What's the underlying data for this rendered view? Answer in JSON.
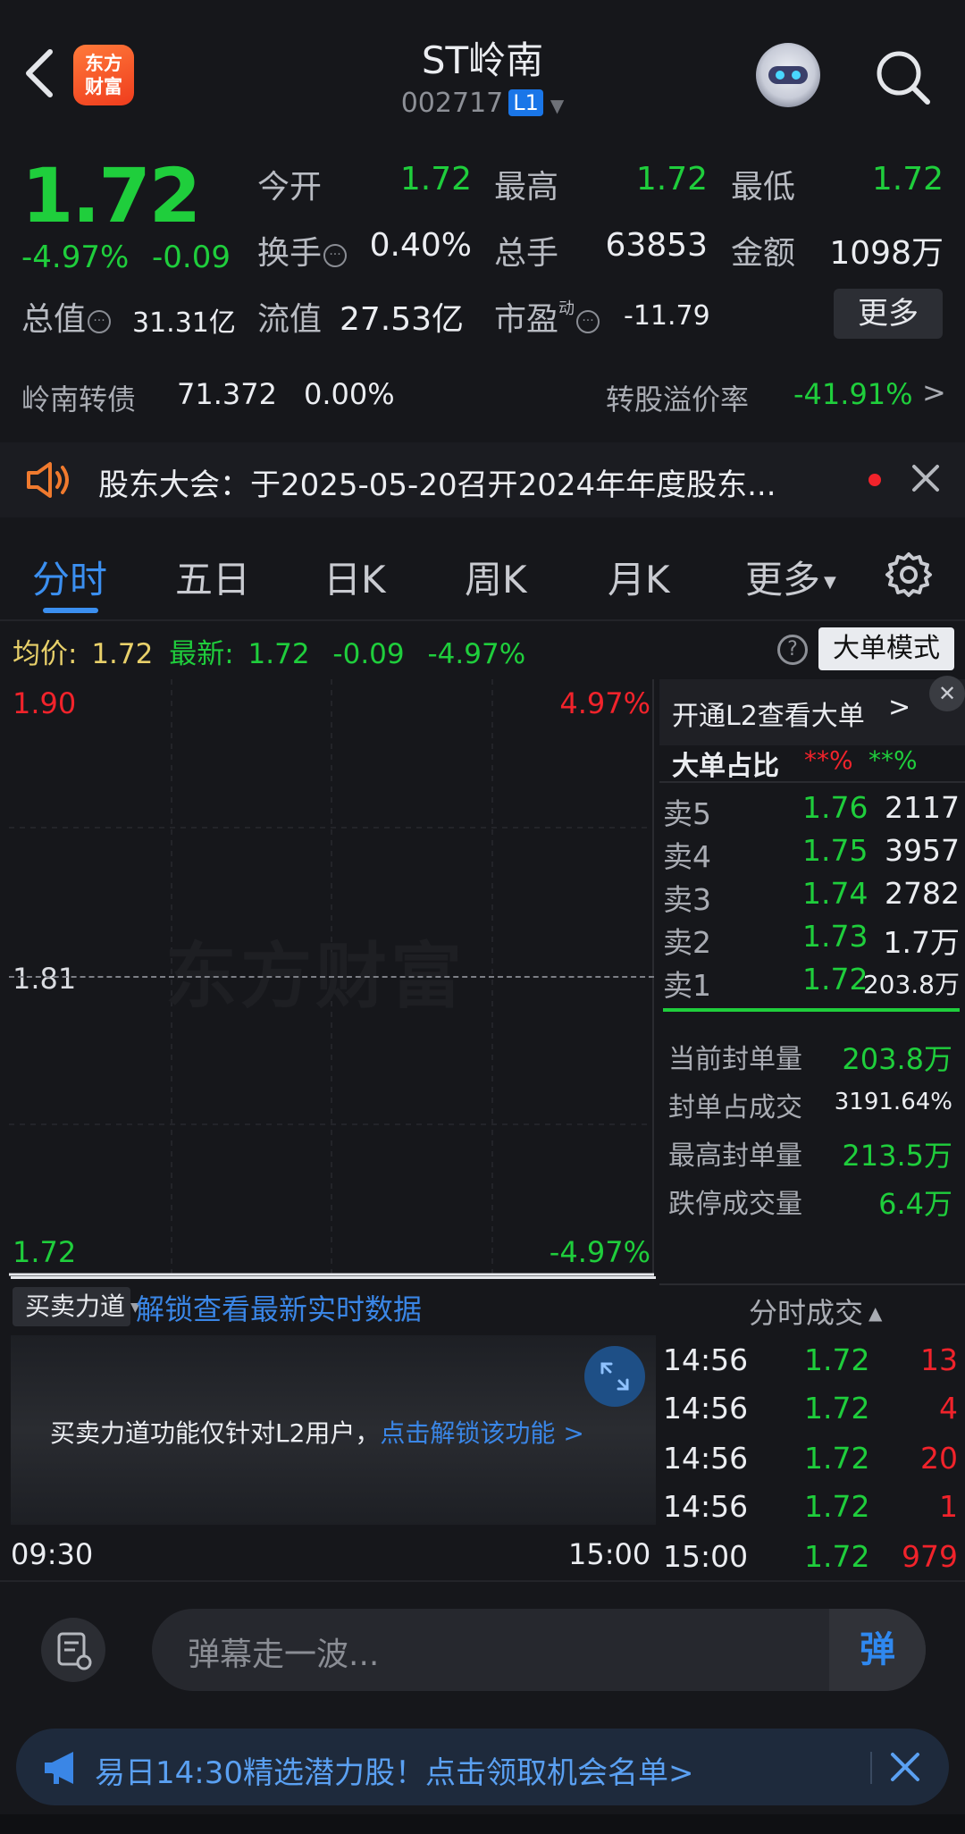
{
  "header": {
    "back_icon": "chevron-left-icon",
    "logo_line1": "东方",
    "logo_line2": "财富",
    "title": "ST岭南",
    "code": "002717",
    "level": "L1",
    "search_icon": "search-icon"
  },
  "quote": {
    "price": "1.72",
    "change_pct": "-4.97%",
    "change_abs": "-0.09",
    "open_label": "今开",
    "open": "1.72",
    "high_label": "最高",
    "high": "1.72",
    "low_label": "最低",
    "low": "1.72",
    "turnover_label": "换手",
    "turnover": "0.40%",
    "volume_label": "总手",
    "volume": "63853",
    "amount_label": "金额",
    "amount": "1098万",
    "mktcap_label": "总值",
    "mktcap": "31.31亿",
    "float_label": "流值",
    "float": "27.53亿",
    "pe_label": "市盈",
    "pe_sup": "动",
    "pe": "-11.79",
    "more_label": "更多"
  },
  "bond": {
    "name": "岭南转债",
    "price": "71.372",
    "change": "0.00%",
    "premium_label": "转股溢价率",
    "premium": "-41.91%"
  },
  "notice": {
    "text": "股东大会：于2025-05-20召开2024年年度股东..."
  },
  "tabs": [
    "分时",
    "五日",
    "日K",
    "周K",
    "月K",
    "更多"
  ],
  "chart_header": {
    "avg_label": "均价:",
    "avg": "1.72",
    "latest_label": "最新:",
    "latest": "1.72",
    "chg": "-0.09",
    "chg_pct": "-4.97%",
    "mode_label": "大单模式"
  },
  "chart": {
    "y_top": "1.90",
    "y_mid": "1.81",
    "y_bottom": "1.72",
    "pct_top": "4.97%",
    "pct_bottom": "-4.97%",
    "watermark": "东方财富",
    "x_start": "09:30",
    "x_end": "15:00"
  },
  "chart_data": {
    "type": "line",
    "x": [
      "09:30",
      "15:00"
    ],
    "series": [
      {
        "values": [
          1.72,
          1.72
        ]
      }
    ],
    "ylim": [
      1.72,
      1.9
    ]
  },
  "orderbook": {
    "l2_link": "开通L2查看大单",
    "big_label": "大单占比",
    "big_buy": "**%",
    "big_sell": "**%",
    "rows": [
      {
        "label": "卖5",
        "price": "1.76",
        "vol": "2117"
      },
      {
        "label": "卖4",
        "price": "1.75",
        "vol": "3957"
      },
      {
        "label": "卖3",
        "price": "1.74",
        "vol": "2782"
      },
      {
        "label": "卖2",
        "price": "1.73",
        "vol": "1.7万"
      },
      {
        "label": "卖1",
        "price": "1.72",
        "vol": "203.8万"
      }
    ]
  },
  "seal": {
    "cur_label": "当前封单量",
    "cur": "203.8万",
    "ratio_label": "封单占成交",
    "ratio": "3191.64%",
    "max_label": "最高封单量",
    "max": "213.5万",
    "limit_label": "跌停成交量",
    "limit": "6.4万"
  },
  "power": {
    "dropdown_label": "买卖力道",
    "unlock_link": "解锁查看最新实时数据",
    "lock_text": "买卖力道功能仅针对L2用户，",
    "lock_link": "点击解锁该功能 >"
  },
  "ticks": {
    "header": "分时成交",
    "rows": [
      {
        "time": "14:56",
        "price": "1.72",
        "vol": "13"
      },
      {
        "time": "14:56",
        "price": "1.72",
        "vol": "4"
      },
      {
        "time": "14:56",
        "price": "1.72",
        "vol": "20"
      },
      {
        "time": "14:56",
        "price": "1.72",
        "vol": "1"
      },
      {
        "time": "15:00",
        "price": "1.72",
        "vol": "979"
      }
    ]
  },
  "chat": {
    "placeholder": "弹幕走一波...",
    "send_label": "弹"
  },
  "ad": {
    "text": "易日14:30精选潜力股！点击领取机会名单>"
  },
  "colors": {
    "up": "#f1232b",
    "down": "#1fce3c",
    "accent": "#3b8ff0",
    "bg": "#16171b"
  }
}
